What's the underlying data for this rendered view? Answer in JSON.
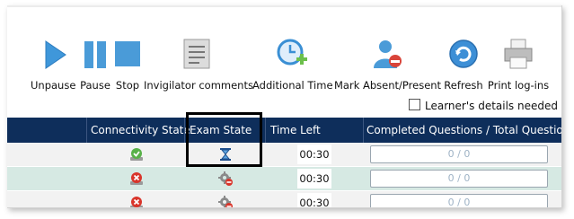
{
  "toolbar": {
    "unpause": "Unpause",
    "pause": "Pause",
    "stop": "Stop",
    "invigilator_comments": "Invigilator comments",
    "additional_time": "Additional Time",
    "mark_absent_present": "Mark Absent/Present",
    "refresh": "Refresh",
    "print_logins": "Print log-ins"
  },
  "learner_details_label": "Learner's details needed",
  "table": {
    "headers": {
      "connectivity": "Connectivity State",
      "exam_state": "Exam State",
      "time_left": "Time Left",
      "completed": "Completed Questions / Total Question"
    },
    "rows": [
      {
        "connectivity": "connected-icon",
        "exam_state": "hourglass-icon",
        "time_left": "00:30",
        "progress": "0 / 0"
      },
      {
        "connectivity": "disconnected-icon",
        "exam_state": "gear-stop-icon",
        "time_left": "00:30",
        "progress": "0 / 0"
      },
      {
        "connectivity": "disconnected-icon",
        "exam_state": "gear-stop-icon",
        "time_left": "00:30",
        "progress": "0 / 0"
      }
    ]
  },
  "colors": {
    "header_bg": "#0e2e5b",
    "row_alt": "#d6e9e3",
    "accent_blue": "#3a8fd4"
  }
}
